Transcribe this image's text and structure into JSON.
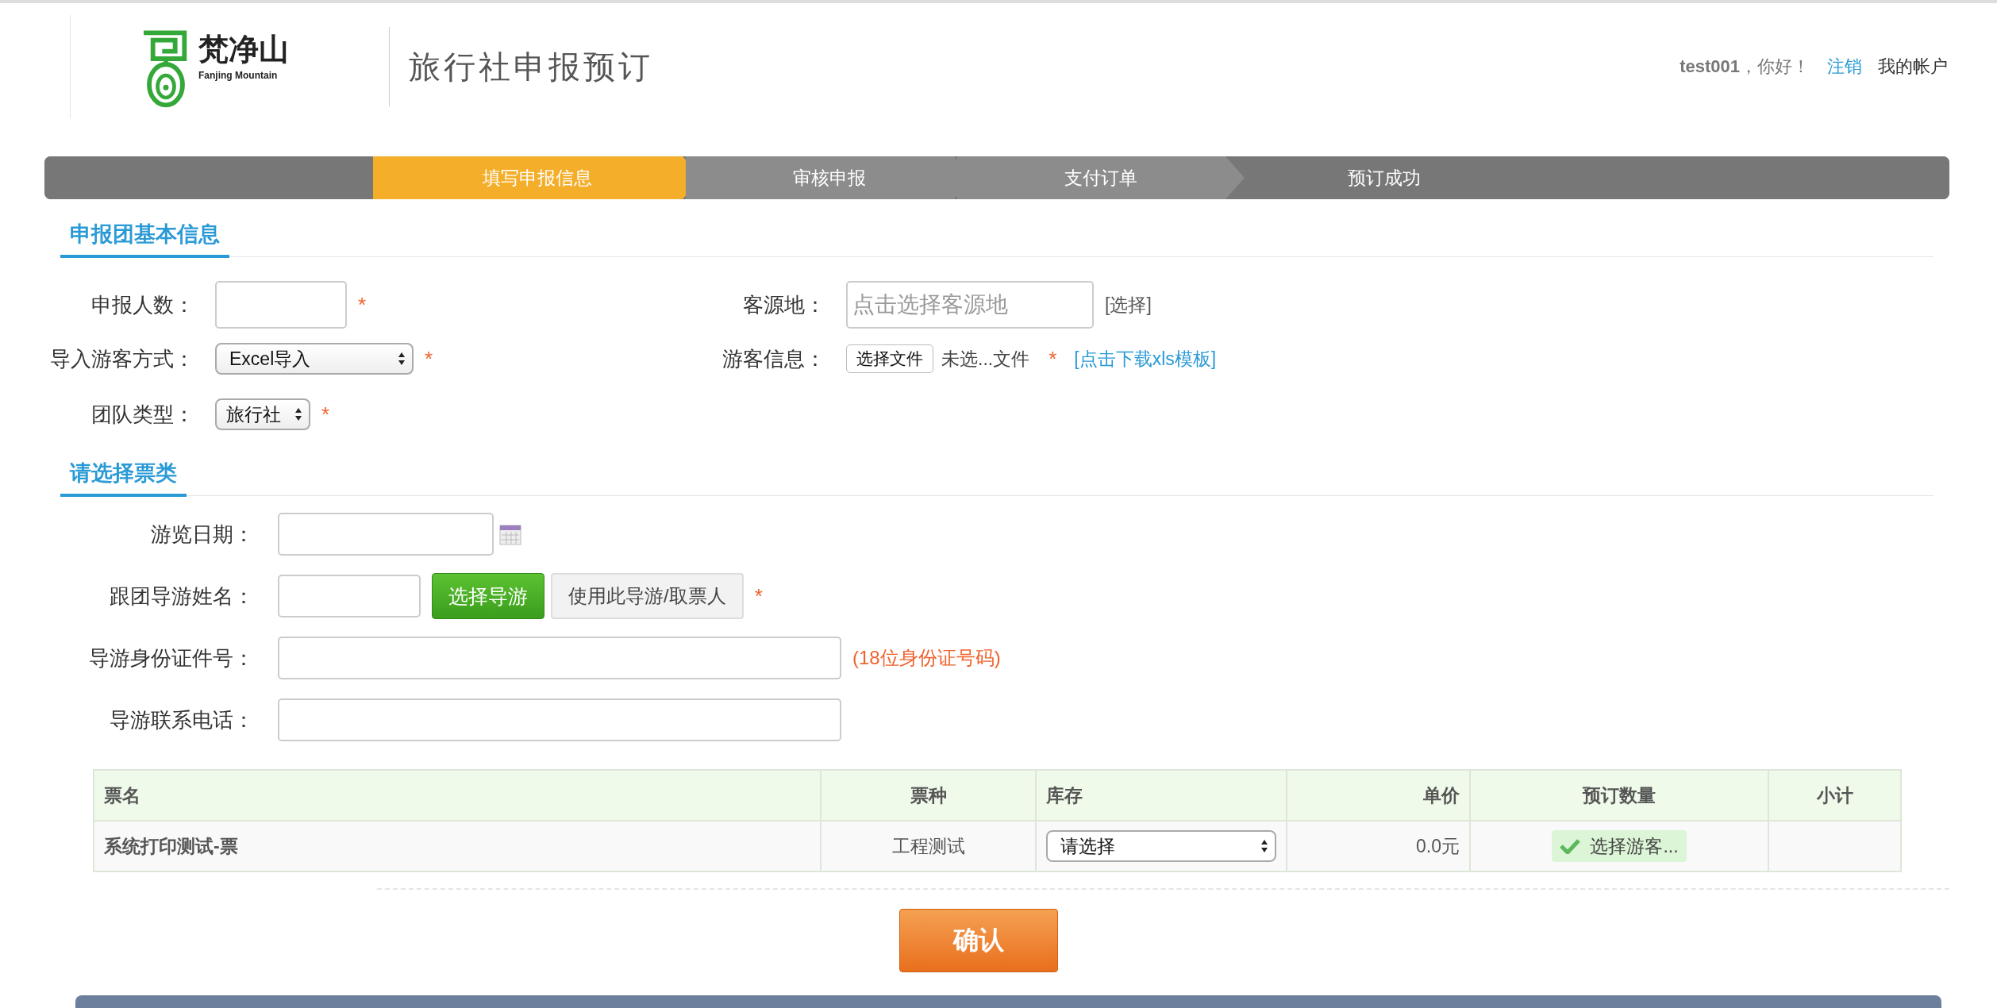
{
  "header": {
    "logo_name": "梵净山",
    "logo_subtitle": "Fanjing Mountain",
    "title": "旅行社申报预订",
    "username": "test001",
    "greeting": "，你好！",
    "logout": "注销",
    "account": "我的帐户"
  },
  "steps": [
    {
      "label": "填写申报信息",
      "selected": true
    },
    {
      "label": "审核申报",
      "selected": false
    },
    {
      "label": "支付订单",
      "selected": false
    },
    {
      "label": "预订成功",
      "selected": false
    }
  ],
  "basic_info": {
    "title": "申报团基本信息",
    "group_size": {
      "label": "申报人数：",
      "required_mark": "*"
    },
    "source": {
      "label": "客源地：",
      "placeholder": "点击选择客源地",
      "link": "[选择]"
    },
    "import_method": {
      "label": "导入游客方式：",
      "value": "Excel导入",
      "required_mark": "*"
    },
    "visitor_info": {
      "label": "游客信息：",
      "button": "选择文件",
      "file_status": "未选...文件",
      "required_mark": "*",
      "link": "[点击下载xls模板]"
    },
    "team_type": {
      "label": "团队类型：",
      "value": "旅行社",
      "required_mark": "*"
    }
  },
  "ticket_section": {
    "title": "请选择票类",
    "date": {
      "label": "游览日期："
    },
    "guide_name": {
      "label": "跟团导游姓名：",
      "select_button": "选择导游",
      "use_button": "使用此导游/取票人",
      "required_mark": "*"
    },
    "guide_id": {
      "label": "导游身份证件号：",
      "hint": "(18位身份证号码)"
    },
    "guide_phone": {
      "label": "导游联系电话："
    }
  },
  "table": {
    "columns": [
      "票名",
      "票种",
      "库存",
      "单价",
      "预订数量",
      "小计"
    ],
    "rows": [
      {
        "name": "系统打印测试-票",
        "type": "工程测试",
        "stock": "请选择",
        "price": "0.0元",
        "quantity_button": "选择游客..."
      }
    ]
  },
  "confirm_button": "确认"
}
